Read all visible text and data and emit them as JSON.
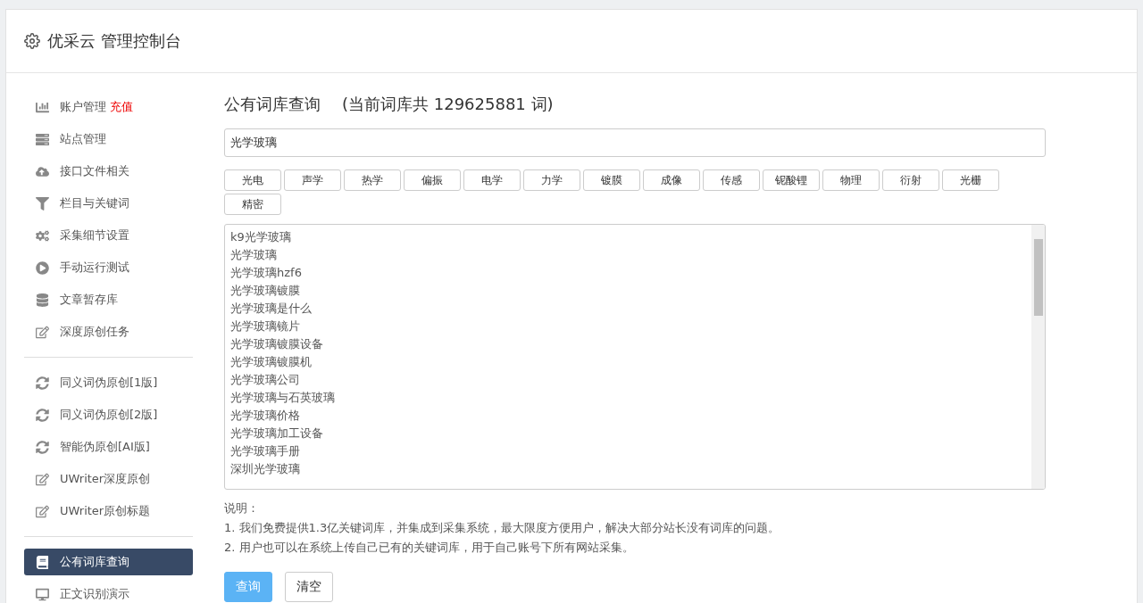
{
  "header": {
    "title": "优采云 管理控制台"
  },
  "sidebar": {
    "groups": [
      {
        "items": [
          {
            "label": "账户管理",
            "badge": "充值",
            "selected": false
          },
          {
            "label": "站点管理",
            "selected": false
          },
          {
            "label": "接口文件相关",
            "selected": false
          },
          {
            "label": "栏目与关键词",
            "selected": false
          },
          {
            "label": "采集细节设置",
            "selected": false
          },
          {
            "label": "手动运行测试",
            "selected": false
          },
          {
            "label": "文章暂存库",
            "selected": false
          },
          {
            "label": "深度原创任务",
            "selected": false
          }
        ]
      },
      {
        "items": [
          {
            "label": "同义词伪原创[1版]",
            "selected": false
          },
          {
            "label": "同义词伪原创[2版]",
            "selected": false
          },
          {
            "label": "智能伪原创[AI版]",
            "selected": false
          },
          {
            "label": "UWriter深度原创",
            "selected": false
          },
          {
            "label": "UWriter原创标题",
            "selected": false
          }
        ]
      },
      {
        "items": [
          {
            "label": "公有词库查询",
            "selected": true
          },
          {
            "label": "正文识别演示",
            "selected": false
          }
        ]
      }
    ]
  },
  "main": {
    "title": "公有词库查询",
    "subtitle": "(当前词库共 129625881 词)",
    "search": {
      "value": "光学玻璃"
    },
    "tags": [
      "光电",
      "声学",
      "热学",
      "偏振",
      "电学",
      "力学",
      "镀膜",
      "成像",
      "传感",
      "铌酸锂",
      "物理",
      "衍射",
      "光栅",
      "精密"
    ],
    "results": [
      "k9光学玻璃",
      "光学玻璃",
      "光学玻璃hzf6",
      "光学玻璃镀膜",
      "光学玻璃是什么",
      "光学玻璃镜片",
      "光学玻璃镀膜设备",
      "光学玻璃镀膜机",
      "光学玻璃公司",
      "光学玻璃与石英玻璃",
      "光学玻璃价格",
      "光学玻璃加工设备",
      "光学玻璃手册",
      "深圳光学玻璃"
    ],
    "notes_title": "说明：",
    "notes": [
      "1. 我们免费提供1.3亿关键词库，并集成到采集系统，最大限度方便用户，解决大部分站长没有词库的问题。",
      "2. 用户也可以在系统上传自己已有的关键词库，用于自己账号下所有网站采集。"
    ],
    "buttons": [
      {
        "label": "查询",
        "kind": "primary"
      },
      {
        "label": "清空",
        "kind": "default"
      }
    ]
  }
}
